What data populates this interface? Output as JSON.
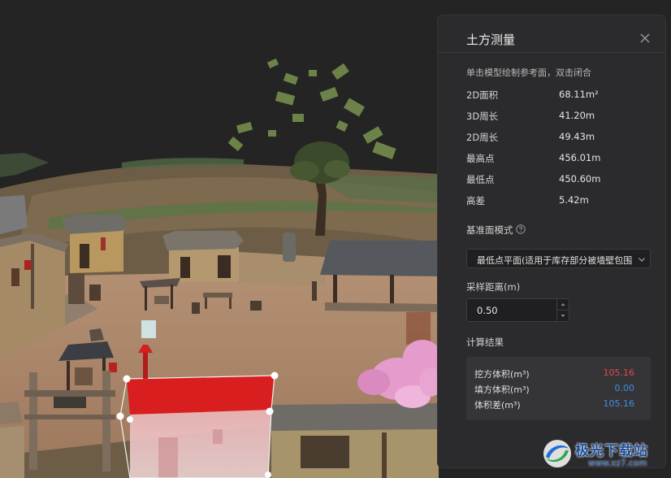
{
  "panel": {
    "title": "土方测量",
    "hint": "单击模型绘制参考面，双击闭合",
    "metrics": [
      {
        "label": "2D面积",
        "value": "68.11m²"
      },
      {
        "label": "3D周长",
        "value": "41.20m"
      },
      {
        "label": "2D周长",
        "value": "49.43m"
      },
      {
        "label": "最高点",
        "value": "456.01m"
      },
      {
        "label": "最低点",
        "value": "450.60m"
      },
      {
        "label": "高差",
        "value": "5.42m"
      }
    ],
    "base_mode_label": "基准面模式",
    "base_mode_value": "最低点平面(适用于库存部分被墙壁包围)",
    "sample_label": "采样距离(m)",
    "sample_value": "0.50",
    "results_label": "计算结果",
    "results": [
      {
        "label": "挖方体积(m³)",
        "value": "105.16",
        "color": "#e5484d"
      },
      {
        "label": "填方体积(m³)",
        "value": "0.00",
        "color": "#3f8fe0"
      },
      {
        "label": "体积差(m³)",
        "value": "105.16",
        "color": "#3f8fe0"
      }
    ]
  },
  "watermark": {
    "text": "极光下载站",
    "url": "www.xz7.com"
  },
  "colors": {
    "panel_bg": "#2b2b2d",
    "accent_red": "#e5484d",
    "accent_blue": "#3f8fe0",
    "selection_roof": "#d81e1e"
  },
  "icons": [
    "close-icon",
    "help-icon",
    "chevron-down-icon",
    "caret-up-icon",
    "caret-down-icon",
    "watermark-logo-icon"
  ]
}
